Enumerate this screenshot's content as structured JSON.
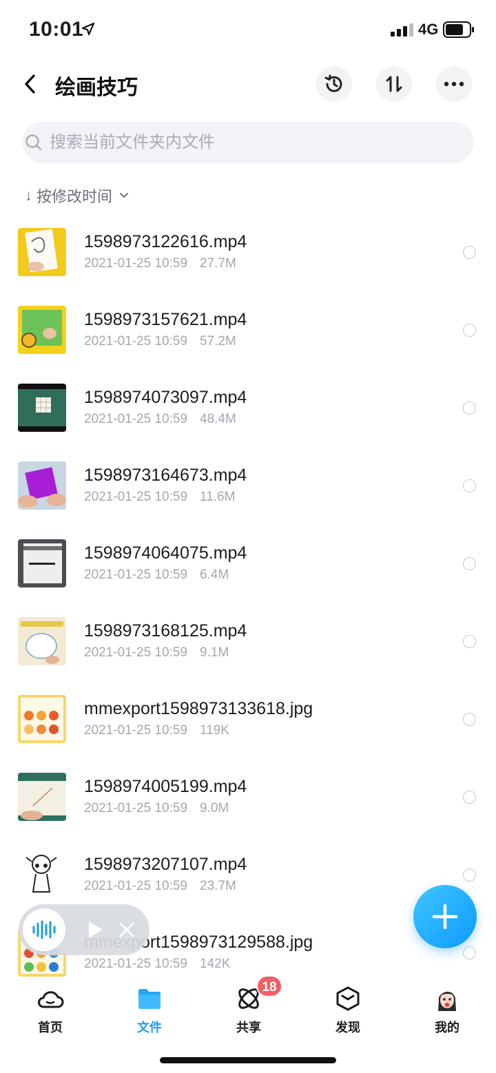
{
  "status_bar": {
    "time": "10:01",
    "network": "4G"
  },
  "header": {
    "title": "绘画技巧"
  },
  "search": {
    "placeholder": "搜索当前文件夹内文件"
  },
  "sort": {
    "label": "按修改时间"
  },
  "files": [
    {
      "name": "1598973122616.mp4",
      "date": "2021-01-25 10:59",
      "size": "27.7M",
      "thumb": "yellow-paper"
    },
    {
      "name": "1598973157621.mp4",
      "date": "2021-01-25 10:59",
      "size": "57.2M",
      "thumb": "green-paper"
    },
    {
      "name": "1598974073097.mp4",
      "date": "2021-01-25 10:59",
      "size": "48.4M",
      "thumb": "cutting-mat"
    },
    {
      "name": "1598973164673.mp4",
      "date": "2021-01-25 10:59",
      "size": "11.6M",
      "thumb": "purple-paper"
    },
    {
      "name": "1598974064075.mp4",
      "date": "2021-01-25 10:59",
      "size": "6.4M",
      "thumb": "pen-on-desk"
    },
    {
      "name": "1598973168125.mp4",
      "date": "2021-01-25 10:59",
      "size": "9.1M",
      "thumb": "drawing-circle"
    },
    {
      "name": "mmexport1598973133618.jpg",
      "date": "2021-01-25 10:59",
      "size": "119K",
      "thumb": "color-chart"
    },
    {
      "name": "1598974005199.mp4",
      "date": "2021-01-25 10:59",
      "size": "9.0M",
      "thumb": "teal-sketch"
    },
    {
      "name": "1598973207107.mp4",
      "date": "2021-01-25 10:59",
      "size": "23.7M",
      "thumb": "cartoon-girl"
    },
    {
      "name": "mmexport1598973129588.jpg",
      "date": "2021-01-25 10:59",
      "size": "142K",
      "thumb": "color-chart-2"
    }
  ],
  "tabs": [
    {
      "label": "首页",
      "icon": "cloud-icon"
    },
    {
      "label": "文件",
      "icon": "folder-icon"
    },
    {
      "label": "共享",
      "icon": "atom-icon"
    },
    {
      "label": "发现",
      "icon": "cube-icon"
    },
    {
      "label": "我的",
      "icon": "avatar-icon"
    }
  ],
  "share_badge": "18",
  "colors": {
    "accent": "#1e9bf0",
    "badge": "#f25f62",
    "fab": "#0e9bff"
  }
}
